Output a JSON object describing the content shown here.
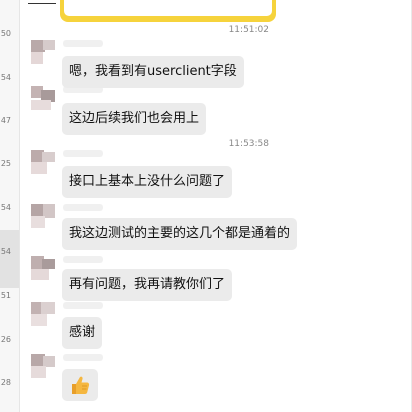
{
  "timestamps": [
    "11:51:02",
    "11:53:58"
  ],
  "left_strip_times": [
    "50",
    "54",
    "47",
    "25",
    "54",
    "54",
    "51",
    "26",
    "28"
  ],
  "messages": [
    "嗯，我看到有userclient字段",
    "这边后续我们也会用上",
    "接口上基本上没什么问题了",
    "我这边测试的主要的这几个都是通着的",
    "再有问题，我再请教你们了",
    "感谢"
  ],
  "last_message_icon": "thumbs-up-icon",
  "colors": {
    "bubble": "#ebebeb",
    "card_yellow": "#f6d33c",
    "thumb": "#f2b33d"
  }
}
